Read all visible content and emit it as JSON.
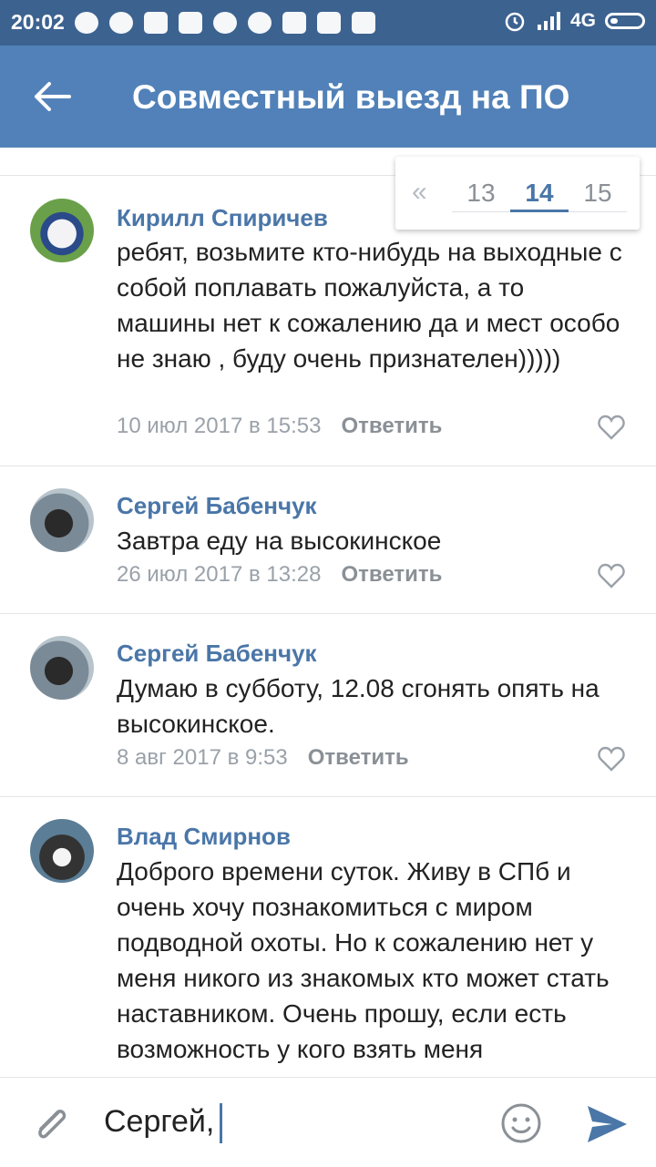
{
  "status_bar": {
    "time": "20:02",
    "network": "4G",
    "left_icons": [
      "telegram-icon",
      "whatsapp-icon",
      "message-icon",
      "mail-icon",
      "heart-icon",
      "chat-icon",
      "youtube-icon",
      "note-icon",
      "note-icon"
    ],
    "right_icons": [
      "alarm-icon",
      "signal-icon",
      "battery-icon"
    ]
  },
  "header": {
    "title": "Совместный выезд на ПО",
    "back_icon": "arrow-left-icon",
    "background": "#5181b8"
  },
  "pagination": {
    "prev_label": "«",
    "pages": [
      "13",
      "14",
      "15"
    ],
    "current": "14"
  },
  "comments": [
    {
      "author": "Кирилл Спиричев",
      "text": "ребят, возьмите кто-нибудь на выходные с собой поплавать пожалуйста, а то машины нет к сожалению да и мест особо не знаю , буду очень признателен)))))",
      "date": "10 июл 2017 в 15:53",
      "reply_label": "Ответить"
    },
    {
      "author": "Сергей Бабенчук",
      "text": "Завтра еду на высокинское",
      "date": "26 июл 2017 в 13:28",
      "reply_label": "Ответить"
    },
    {
      "author": "Сергей Бабенчук",
      "text": "Думаю в субботу, 12.08 сгонять опять на высокинское.",
      "date": "8 авг 2017 в 9:53",
      "reply_label": "Ответить"
    },
    {
      "author": "Влад Смирнов",
      "text": "Доброго времени суток. Живу в СПб и очень хочу познакомиться с миром подводной охоты. Но к сожалению нет у меня никого из знакомых кто может стать наставником. Очень прошу, если есть возможность у кого взять меня"
    }
  ],
  "composer": {
    "value": "Сергей,",
    "attach_icon": "paperclip-icon",
    "emoji_icon": "smiley-icon",
    "send_icon": "send-icon",
    "accent": "#4a76a8"
  },
  "colors": {
    "status_bar": "#3c6290",
    "author": "#4a76a8",
    "meta": "#9aa1a9"
  }
}
